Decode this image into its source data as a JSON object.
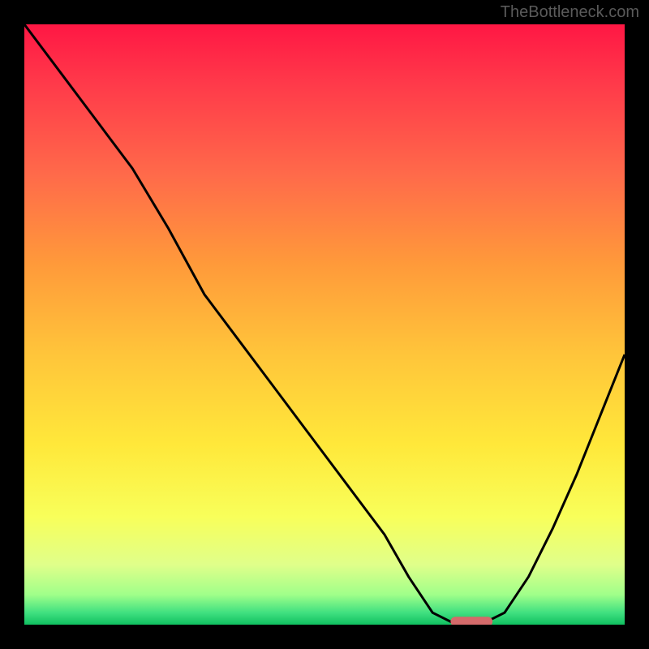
{
  "watermark": "TheBottleneck.com",
  "chart_data": {
    "type": "line",
    "title": "",
    "xlabel": "",
    "ylabel": "",
    "xlim": [
      0,
      100
    ],
    "ylim": [
      0,
      100
    ],
    "grid": false,
    "series": [
      {
        "name": "bottleneck-curve",
        "x": [
          0,
          6,
          12,
          18,
          24,
          30,
          36,
          42,
          48,
          54,
          60,
          64,
          68,
          72,
          76,
          80,
          84,
          88,
          92,
          96,
          100
        ],
        "y": [
          100,
          92,
          84,
          76,
          66,
          55,
          47,
          39,
          31,
          23,
          15,
          8,
          2,
          0,
          0,
          2,
          8,
          16,
          25,
          35,
          45
        ]
      }
    ],
    "marker": {
      "x_start": 71,
      "x_end": 78,
      "y": 0.5,
      "color": "#d46a6a"
    },
    "background_gradient": {
      "stops": [
        {
          "offset": 0.0,
          "color": "#ff1744"
        },
        {
          "offset": 0.1,
          "color": "#ff3a4a"
        },
        {
          "offset": 0.25,
          "color": "#ff6a4a"
        },
        {
          "offset": 0.4,
          "color": "#ff9a3a"
        },
        {
          "offset": 0.55,
          "color": "#ffc53a"
        },
        {
          "offset": 0.7,
          "color": "#ffe83a"
        },
        {
          "offset": 0.82,
          "color": "#f8ff5a"
        },
        {
          "offset": 0.9,
          "color": "#e0ff8a"
        },
        {
          "offset": 0.95,
          "color": "#a0ff8a"
        },
        {
          "offset": 0.98,
          "color": "#40e080"
        },
        {
          "offset": 1.0,
          "color": "#10c060"
        }
      ]
    }
  }
}
